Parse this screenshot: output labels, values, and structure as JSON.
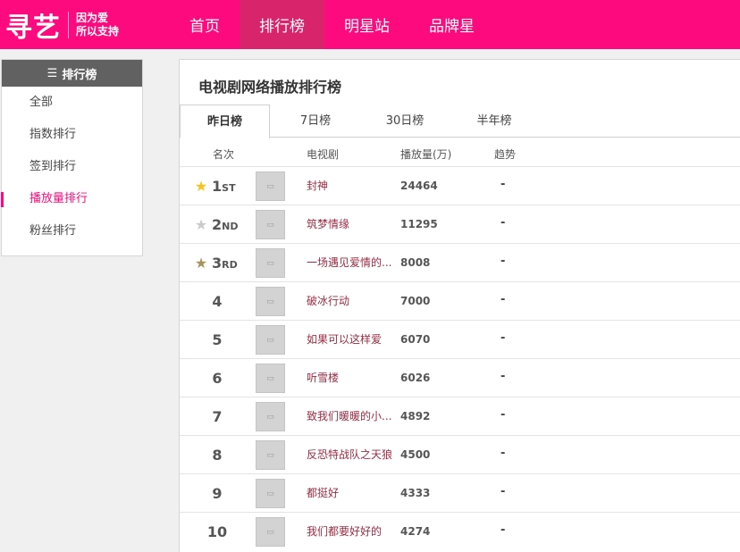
{
  "logo": {
    "main": "寻艺",
    "slogan_line1": "因为爱",
    "slogan_line2": "所以支持"
  },
  "nav": [
    {
      "label": "首页",
      "active": false
    },
    {
      "label": "排行榜",
      "active": true
    },
    {
      "label": "明星站",
      "active": false
    },
    {
      "label": "品牌星",
      "active": false
    }
  ],
  "sidebar": {
    "title": "排行榜",
    "title_icon": "list-icon",
    "items": [
      {
        "label": "全部",
        "active": false
      },
      {
        "label": "指数排行",
        "active": false
      },
      {
        "label": "签到排行",
        "active": false
      },
      {
        "label": "播放量排行",
        "active": true
      },
      {
        "label": "粉丝排行",
        "active": false
      }
    ]
  },
  "panel": {
    "title": "电视剧网络播放排行榜",
    "tabs": [
      {
        "label": "昨日榜",
        "active": true
      },
      {
        "label": "7日榜",
        "active": false
      },
      {
        "label": "30日榜",
        "active": false
      },
      {
        "label": "半年榜",
        "active": false
      }
    ],
    "columns": {
      "rank": "名次",
      "drama": "电视剧",
      "plays": "播放量(万)",
      "trend": "趋势"
    }
  },
  "rows": [
    {
      "rank": "1",
      "suffix": "ST",
      "star": "gold",
      "title": "封神",
      "plays": "24464",
      "trend": "-"
    },
    {
      "rank": "2",
      "suffix": "ND",
      "star": "silver",
      "title": "筑梦情缘",
      "plays": "11295",
      "trend": "-"
    },
    {
      "rank": "3",
      "suffix": "RD",
      "star": "bronze",
      "title": "一场遇见爱情的...",
      "plays": "8008",
      "trend": "-"
    },
    {
      "rank": "4",
      "title": "破冰行动",
      "plays": "7000",
      "trend": "-"
    },
    {
      "rank": "5",
      "title": "如果可以这样爱",
      "plays": "6070",
      "trend": "-"
    },
    {
      "rank": "6",
      "title": "听雪楼",
      "plays": "6026",
      "trend": "-"
    },
    {
      "rank": "7",
      "title": "致我们暖暖的小...",
      "plays": "4892",
      "trend": "-"
    },
    {
      "rank": "8",
      "title": "反恐特战队之天狼",
      "plays": "4500",
      "trend": "-"
    },
    {
      "rank": "9",
      "title": "都挺好",
      "plays": "4333",
      "trend": "-"
    },
    {
      "rank": "10",
      "title": "我们都要好好的",
      "plays": "4274",
      "trend": "-"
    }
  ],
  "colors": {
    "brand": "#fc0a7e",
    "nav_active": "#d8246b",
    "title_link": "#9b2c43"
  }
}
